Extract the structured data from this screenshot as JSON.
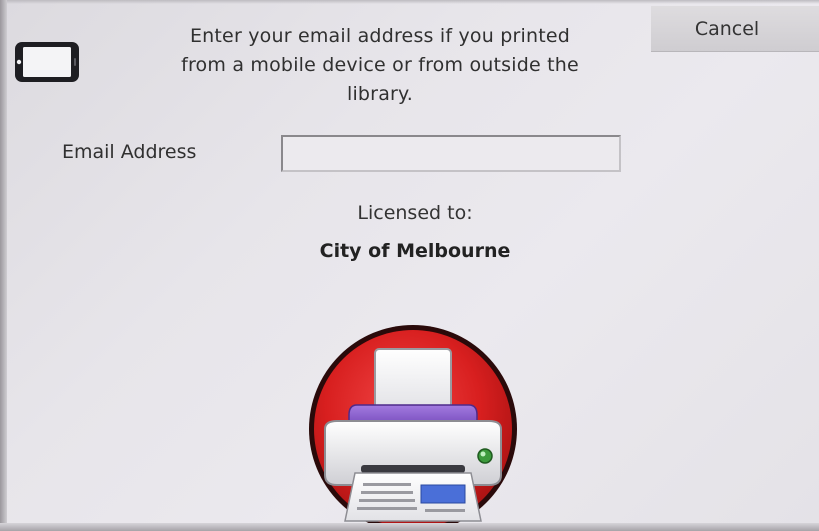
{
  "message": {
    "line1": "Enter your email address if you printed",
    "line2": "from a mobile device or from outside the",
    "line3": "library."
  },
  "cancel_label": "Cancel",
  "email": {
    "label": "Email Address",
    "value": "",
    "placeholder": ""
  },
  "license": {
    "label": "Licensed to:",
    "licensee": "City of Melbourne"
  },
  "icons": {
    "device": "mobile-device-icon",
    "logo": "printer-logo"
  },
  "colors": {
    "logo_red": "#d81f1f",
    "logo_purple": "#7d4fc4",
    "background": "#e8e6eb"
  }
}
